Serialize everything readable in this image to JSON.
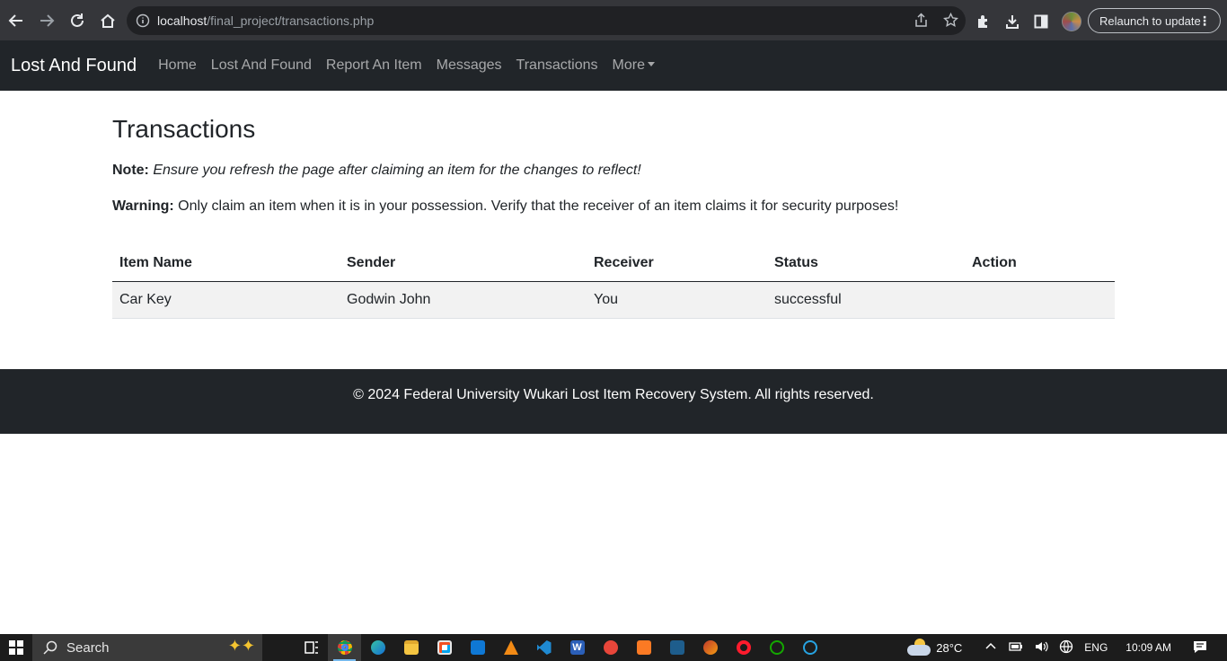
{
  "browser": {
    "url_host": "localhost",
    "url_path": "/final_project/transactions.php",
    "relaunch_label": "Relaunch to update"
  },
  "navbar": {
    "brand": "Lost And Found",
    "links": [
      "Home",
      "Lost And Found",
      "Report An Item",
      "Messages",
      "Transactions",
      "More"
    ]
  },
  "main": {
    "title": "Transactions",
    "note_label": "Note:",
    "note_text": " Ensure you refresh the page after claiming an item for the changes to reflect!",
    "warning_label": "Warning:",
    "warning_text": " Only claim an item when it is in your possession. Verify that the receiver of an item claims it for security purposes!",
    "table": {
      "headers": [
        "Item Name",
        "Sender",
        "Receiver",
        "Status",
        "Action"
      ],
      "rows": [
        [
          "Car Key",
          "Godwin John",
          "You",
          "successful",
          ""
        ]
      ]
    }
  },
  "footer": {
    "text": "© 2024 Federal University Wukari Lost Item Recovery System. All rights reserved."
  },
  "taskbar": {
    "search_placeholder": "Search",
    "temperature": "28°C",
    "language": "ENG",
    "time": "10:09 AM"
  }
}
